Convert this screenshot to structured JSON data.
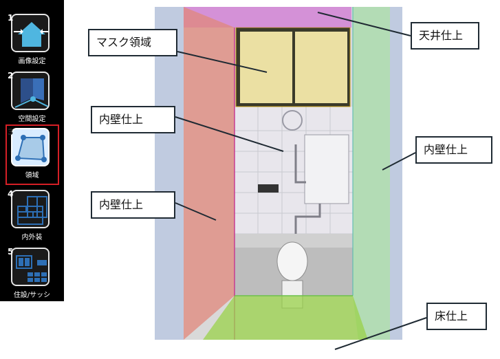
{
  "toolbar": {
    "items": [
      {
        "number": "1",
        "label": "画像設定",
        "icon": "house-compress-icon"
      },
      {
        "number": "2",
        "label": "空間設定",
        "icon": "room-space-icon"
      },
      {
        "number": "3",
        "label": "領域",
        "icon": "region-polygon-icon",
        "active": true
      },
      {
        "number": "4",
        "label": "内外装",
        "icon": "tile-wall-icon"
      },
      {
        "number": "5",
        "label": "住設/サッシ",
        "icon": "window-sash-icon"
      }
    ],
    "active_color": "#d61f26"
  },
  "callouts": {
    "mask_region": "マスク領域",
    "ceiling_finish": "天井仕上",
    "inner_wall_center": "内壁仕上",
    "inner_wall_right": "内壁仕上",
    "inner_wall_left": "内壁仕上",
    "floor_finish": "床仕上"
  },
  "overlay_colors": {
    "ceiling": "#d26bd6",
    "mask": "#fff3b0",
    "left_wall": "#e36a5a",
    "right_wall": "#86e08a",
    "floor": "#9ad24a"
  }
}
